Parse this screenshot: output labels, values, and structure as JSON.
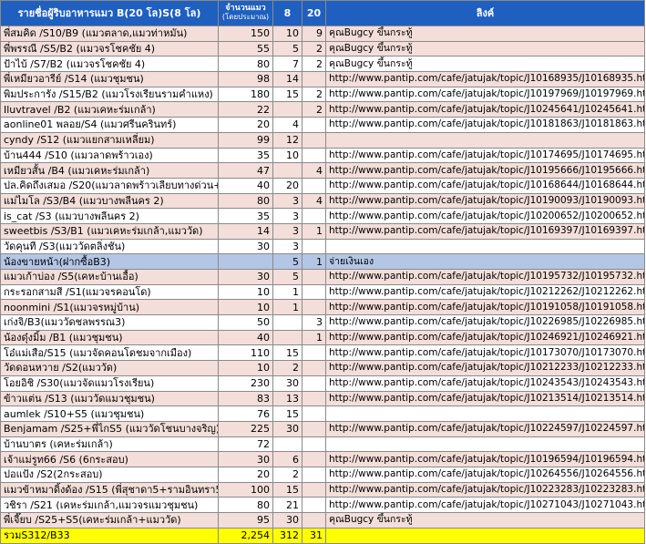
{
  "header": {
    "name": "รายชื่อผู้ริบอาหารแมว  B(20 โล)S(8 โล)",
    "amount_line1": "จำนวนแมว",
    "amount_line2": "(โดยประมาณ)",
    "col8": "8",
    "col20": "20",
    "link": "ลิงค์"
  },
  "rows": [
    {
      "name": "พี่สมคิด  /S10/B9 (แมวตลาด,แมวท่าหมัน)",
      "amount": "150",
      "s": "10",
      "b": "9",
      "link": "คุณBugcy ขึ้นกระทู้",
      "style": "alt"
    },
    {
      "name": "พี่พรรณี  /S5/B2 (แมวจรโชคชัย  4)",
      "amount": "55",
      "s": "5",
      "b": "2",
      "link": "คุณBugcy ขึ้นกระทู้",
      "style": "alt"
    },
    {
      "name": "ป้าไบ้  /S7/B2 (แมวจรโชคชัย  4)",
      "amount": "80",
      "s": "7",
      "b": "2",
      "link": "คุณBugcy ขึ้นกระทู้",
      "style": "norm"
    },
    {
      "name": "พี่เหมียวอารีย์  /S14 (แมวชุมชน)",
      "amount": "98",
      "s": "14",
      "b": "",
      "link": "http://www.pantip.com/cafe/jatujak/topic/J10168935/J10168935.html",
      "style": "alt"
    },
    {
      "name": "พิมประการัง  /S15/B2 (แมวโรงเรียนรามคำแหง)",
      "amount": "180",
      "s": "15",
      "b": "2",
      "link": "http://www.pantip.com/cafe/jatujak/topic/J10197969/J10197969.html",
      "style": "norm"
    },
    {
      "name": "Iluvtravel /B2 (แมวเคหะร่มเกล้า)",
      "amount": "22",
      "s": "",
      "b": "2",
      "link": "http://www.pantip.com/cafe/jatujak/topic/J10245641/J10245641.html",
      "style": "alt"
    },
    {
      "name": "aonline01 พลอย/S4 (แมวศรีนครินทร์)",
      "amount": "20",
      "s": "4",
      "b": "",
      "link": "http://www.pantip.com/cafe/jatujak/topic/J10181863/J10181863.html",
      "style": "norm"
    },
    {
      "name": "cyndy /S12 (แมวแยกสามเหลี่ยม)",
      "amount": "99",
      "s": "12",
      "b": "",
      "link": "",
      "style": "alt"
    },
    {
      "name": "บ้าน444 /S10 (แมวลาดพร้าวเอง)",
      "amount": "35",
      "s": "10",
      "b": "",
      "link": "http://www.pantip.com/cafe/jatujak/topic/J10174695/J10174695.html",
      "style": "norm"
    },
    {
      "name": "เหมียวสั้น  /B4 (แมวเคหะร่มเกล้า)",
      "amount": "47",
      "s": "",
      "b": "4",
      "link": "http://www.pantip.com/cafe/jatujak/topic/J10195666/J10195666.html",
      "style": "alt"
    },
    {
      "name": "ปล.คิดถึงเสมอ  /S20(แมวลาดพร้าวเลียบทางด่วน+รังสิต)",
      "amount": "40",
      "s": "20",
      "b": "",
      "link": "http://www.pantip.com/cafe/jatujak/topic/J10168644/J10168644.html",
      "style": "norm"
    },
    {
      "name": "แม่ไมโล  /S3/B4 (แมวบางพลีนคร  2)",
      "amount": "80",
      "s": "3",
      "b": "4",
      "link": "http://www.pantip.com/cafe/jatujak/topic/J10190093/J10190093.html",
      "style": "alt"
    },
    {
      "name": "is_cat /S3 (แมวบางพลีนคร  2)",
      "amount": "35",
      "s": "3",
      "b": "",
      "link": "http://www.pantip.com/cafe/jatujak/topic/J10200652/J10200652.html",
      "style": "norm"
    },
    {
      "name": "sweetbis /S3/B1 (แมวเคหะร่มเกล้า,แมววัด)",
      "amount": "14",
      "s": "3",
      "b": "1",
      "link": "http://www.pantip.com/cafe/jatujak/topic/J10169397/J10169397.html",
      "style": "alt"
    },
    {
      "name": "วัดคุนที  /S3(แมววัดตลิ่งชัน)",
      "amount": "30",
      "s": "3",
      "b": "",
      "link": "",
      "style": "norm"
    },
    {
      "name": "น้องขายหน้า(ฝากซื้อB3)",
      "amount": "",
      "s": "5",
      "b": "1",
      "link": "จ่ายเงินเอง",
      "style": "blue"
    },
    {
      "name": "แมวเก้าบ่อง  /S5(เคหะบ้านเอื้อ)",
      "amount": "30",
      "s": "5",
      "b": "",
      "link": "http://www.pantip.com/cafe/jatujak/topic/J10195732/J10195732.html",
      "style": "alt"
    },
    {
      "name": "กระรอกสามสี  /S1(แมวจรคอนโด)",
      "amount": "10",
      "s": "1",
      "b": "",
      "link": "http://www.pantip.com/cafe/jatujak/topic/J10212262/J10212262.html",
      "style": "norm"
    },
    {
      "name": "noonmini /S1(แมวจรหมู่บ้าน)",
      "amount": "10",
      "s": "1",
      "b": "",
      "link": "http://www.pantip.com/cafe/jatujak/topic/J10191058/J10191058.html",
      "style": "alt"
    },
    {
      "name": "เก่งจิ/B3(แมววัดชลพรรณ3)",
      "amount": "50",
      "s": "",
      "b": "3",
      "link": "http://www.pantip.com/cafe/jatujak/topic/J10226985/J10226985.html",
      "style": "norm"
    },
    {
      "name": "น้องดุ๋งมิ้ม  /B1 (แมวชุมชน)",
      "amount": "40",
      "s": "",
      "b": "1",
      "link": "http://www.pantip.com/cafe/jatujak/topic/J10246921/J10246921.html",
      "style": "alt"
    },
    {
      "name": "โอ๋แม่เสือ/S15 (แมวจัดคอนโดชมจากเมือง)",
      "amount": "110",
      "s": "15",
      "b": "",
      "link": "http://www.pantip.com/cafe/jatujak/topic/J10173070/J10173070.html",
      "style": "norm"
    },
    {
      "name": "วัดดอนหวาย  /S2(แมววัด)",
      "amount": "10",
      "s": "2",
      "b": "",
      "link": "http://www.pantip.com/cafe/jatujak/topic/J10212233/J10212233.html",
      "style": "alt"
    },
    {
      "name": "โอยอิชิ  /S30(แมวจัดแมวโรงเรียน)",
      "amount": "230",
      "s": "30",
      "b": "",
      "link": "http://www.pantip.com/cafe/jatujak/topic/J10243543/J10243543.html",
      "style": "norm"
    },
    {
      "name": "ข้าวแต่น  /S13 (แมววัดแมวชุมชน)",
      "amount": "83",
      "s": "13",
      "b": "",
      "link": "http://www.pantip.com/cafe/jatujak/topic/J10213514/J10213514.html",
      "style": "alt"
    },
    {
      "name": "aumlek /S10+S5 (แมวชุมชน)",
      "amount": "76",
      "s": "15",
      "b": "",
      "link": "",
      "style": "norm"
    },
    {
      "name": "Benjamam /S25+พี่ไกS5  (แมววัดโชนบางจริญ)",
      "amount": "225",
      "s": "30",
      "b": "",
      "link": "http://www.pantip.com/cafe/jatujak/topic/J10224597/J10224597.html",
      "style": "alt"
    },
    {
      "name": "บ้านบาตร  (เคหะร่มเกล้า)",
      "amount": "72",
      "s": "",
      "b": "",
      "link": "",
      "style": "norm"
    },
    {
      "name": "เจ้าแม่รูท66 /S6 (6กระสอบ)",
      "amount": "30",
      "s": "6",
      "b": "",
      "link": "http://www.pantip.com/cafe/jatujak/topic/J10196594/J10196594.html",
      "style": "alt"
    },
    {
      "name": "ปอแป้ง  /S2(2กระสอบ)",
      "amount": "20",
      "s": "2",
      "b": "",
      "link": "http://www.pantip.com/cafe/jatujak/topic/J10264556/J10264556.html",
      "style": "norm"
    },
    {
      "name": "แมวข้าหมาดิ้งด้อง /S15 (พี่สุชาดา5+รามอินทรา5)",
      "amount": "100",
      "s": "15",
      "b": "",
      "link": "http://www.pantip.com/cafe/jatujak/topic/J10223283/J10223283.html",
      "style": "alt"
    },
    {
      "name": "วชิรา  /S21 (เคหะร่มเกล้า,แมวจรแมวชุมชน)",
      "amount": "80",
      "s": "21",
      "b": "",
      "link": "http://www.pantip.com/cafe/jatujak/topic/J10271043/J10271043.html",
      "style": "norm"
    },
    {
      "name": "พี่เจี๊ยบ  /S25+S5(เคหะร่มเกล้า+แมววัด)",
      "amount": "95",
      "s": "30",
      "b": "",
      "link": "คุณBugcy ขึ้นกระทู้",
      "style": "alt"
    }
  ],
  "total": {
    "name": "รวมS312/B33",
    "amount": "2,254",
    "s": "312",
    "b": "31",
    "link": ""
  }
}
